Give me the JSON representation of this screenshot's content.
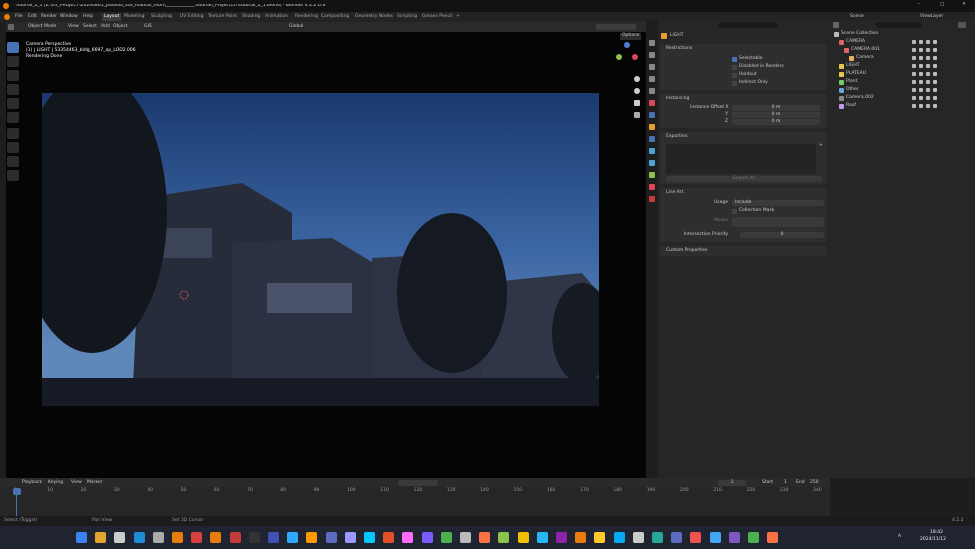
{
  "window": {
    "title": "* Tutorial_2_1 [Z:\\01_PROJECT\\20240801_plateau_ssd_matsuii_mori\\_____________Tutorial\\_Project\\57\\tutorial_2_1.blend] - Blender 4.2.2 LTS",
    "min": "–",
    "max": "□",
    "close": "✕"
  },
  "menu": [
    "File",
    "Edit",
    "Render",
    "Window",
    "Help"
  ],
  "workspaces": [
    "Layout",
    "Modeling",
    "Sculpting",
    "UV Editing",
    "Texture Paint",
    "Shading",
    "Animation",
    "Rendering",
    "Compositing",
    "Geometry Nodes",
    "Scripting",
    "Grease Pencil"
  ],
  "workspace_add": "+",
  "top_right": {
    "scene_label": "Scene",
    "viewlayer_label": "ViewLayer"
  },
  "viewport_header": {
    "mode": "Object Mode",
    "items": [
      "View",
      "Select",
      "Add",
      "Object"
    ],
    "gis": "GIS",
    "transform": "Global"
  },
  "viewport_overlay": {
    "line1": "Camera Perspective",
    "line2": "(1) | LIGHT | 53354463_bldg_6697_op_LOD2.006",
    "line3": "Rendering Done"
  },
  "options_label": "Options",
  "props_search_placeholder": "",
  "props": {
    "object_name": "LIGHT",
    "restrictions": {
      "header": "Restrictions",
      "items": [
        {
          "label": "Selectable",
          "checked": true
        },
        {
          "label": "Disabled in Renders",
          "checked": false
        },
        {
          "label": "Holdout",
          "checked": false
        },
        {
          "label": "Indirect Only",
          "checked": false
        }
      ]
    },
    "instancing": {
      "header": "Instancing",
      "rows": [
        {
          "label": "Instance Offset X",
          "value": "0 m"
        },
        {
          "label": "Y",
          "value": "0 m"
        },
        {
          "label": "Z",
          "value": "0 m"
        }
      ]
    },
    "exporters": {
      "header": "Exporters",
      "add": "+",
      "button": "Export All"
    },
    "lineart": {
      "header": "Line Art",
      "usage_label": "Usage",
      "usage_value": "Include",
      "collection_mask": "Collection Mask",
      "masks_label": "Masks",
      "priority_label": "Intersection Priority",
      "priority_value": "0"
    },
    "custom": {
      "header": "Custom Properties"
    }
  },
  "outliner": {
    "search_placeholder": "",
    "rows": [
      {
        "label": "Scene Collection",
        "color": "#bbbbbb",
        "indent": 0
      },
      {
        "label": "CAMERA",
        "color": "#e06666",
        "indent": 1
      },
      {
        "label": "CAMERA.001",
        "color": "#e06666",
        "indent": 2
      },
      {
        "label": "Camera",
        "color": "#e6b35a",
        "indent": 3
      },
      {
        "label": "LIGHT",
        "color": "#e6c84e",
        "indent": 1
      },
      {
        "label": "PLATEAU",
        "color": "#e6c84e",
        "indent": 1
      },
      {
        "label": "Plant",
        "color": "#6ccf6c",
        "indent": 1
      },
      {
        "label": "Other",
        "color": "#6aa3e0",
        "indent": 1
      },
      {
        "label": "Camera.002",
        "color": "#888888",
        "indent": 1
      },
      {
        "label": "Roof",
        "color": "#c49ae8",
        "indent": 1
      }
    ]
  },
  "timeline": {
    "menu": [
      "Playback",
      "Keying",
      "View",
      "Marker"
    ],
    "current_frame": "1",
    "start_label": "Start",
    "start": "1",
    "end_label": "End",
    "end": "250",
    "ticks": [
      "0",
      "10",
      "20",
      "30",
      "40",
      "50",
      "60",
      "70",
      "80",
      "90",
      "100",
      "110",
      "120",
      "130",
      "140",
      "150",
      "160",
      "170",
      "180",
      "190",
      "200",
      "210",
      "220",
      "230",
      "240"
    ]
  },
  "statusbar": {
    "left": "Select (Toggle)",
    "mid1": "Pan View",
    "mid2": "Set 3D Cursor",
    "version": "4.2.2"
  },
  "taskbar": {
    "time": "18:42",
    "date": "2024/11/12",
    "lang": "A"
  },
  "colors": {
    "accent": "#4772b3",
    "select": "#e89d2c",
    "bg": "#1d1d1d"
  }
}
